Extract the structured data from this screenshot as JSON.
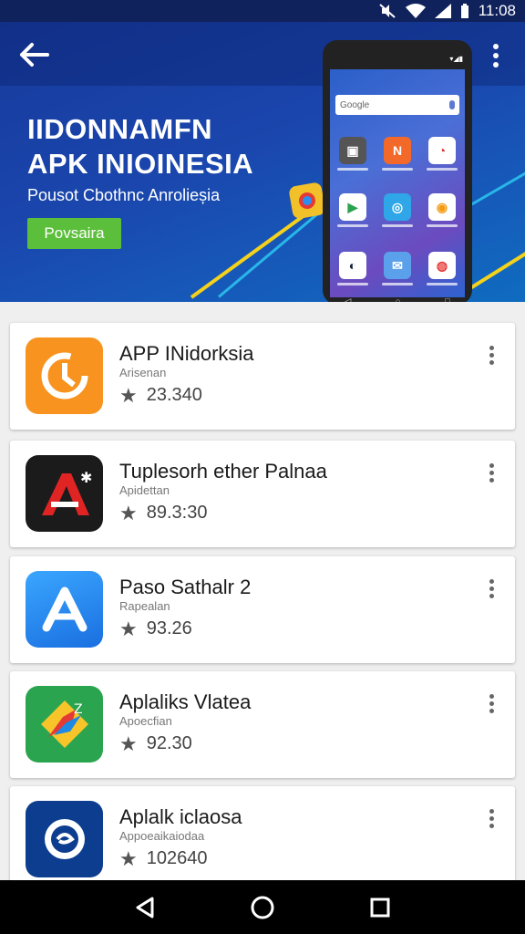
{
  "status_bar": {
    "time": "11:08"
  },
  "hero": {
    "title_line1": "IIDONNAMFN",
    "title_line2": "APK INIOINESIA",
    "subtitle": "Pousot Cbothnc Anrolieșia",
    "button_label": "Povsaira"
  },
  "phone_mockup": {
    "search_text": "Google"
  },
  "apps": [
    {
      "name": "APP INidorksia",
      "developer": "Arisenan",
      "rating": "23.340"
    },
    {
      "name": "Tuplesorh ether Palnaa",
      "developer": "Apidettan",
      "rating": "89.3:30"
    },
    {
      "name": "Paso Sathalr 2",
      "developer": "Rapealan",
      "rating": "93.26"
    },
    {
      "name": "Aplaliks Vlatea",
      "developer": "Apoecfian",
      "rating": "92.30"
    },
    {
      "name": "Aplalk iclaosa",
      "developer": "Appoeaikaiodaa",
      "rating": "102640"
    }
  ],
  "colors": {
    "hero_bg": "#1a46ad",
    "accent_green": "#5cbf3b",
    "accent_yellow": "#f4d21c",
    "app1": "#f7931e",
    "app2": "#1b1b1b",
    "app3": "#2b8ff0",
    "app4": "#2aa44f",
    "app5": "#0d3d8f"
  },
  "icons": {
    "back": "arrow-left-icon",
    "menu": "more-vert-icon",
    "star": "star-icon",
    "nav": [
      "back-triangle-icon",
      "home-circle-icon",
      "recents-square-icon"
    ]
  }
}
